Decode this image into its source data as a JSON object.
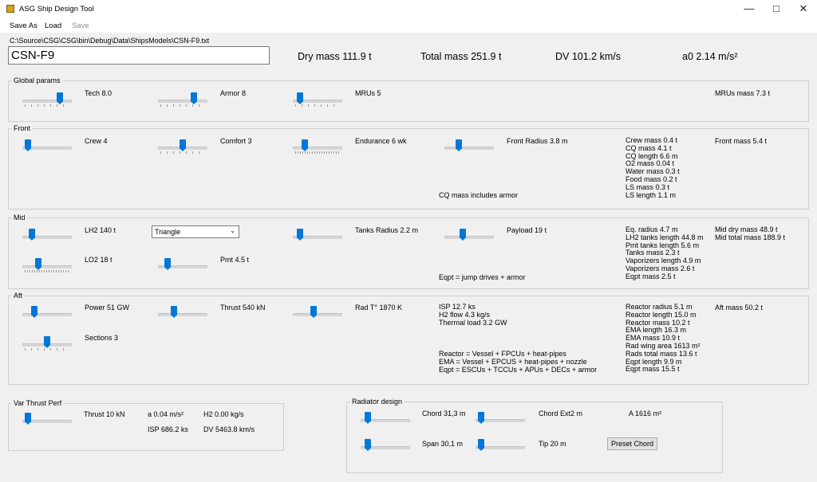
{
  "window": {
    "title": "ASG Ship Design Tool",
    "minimize_icon": "minimize-icon",
    "maximize_icon": "maximize-icon",
    "close_icon": "close-icon"
  },
  "menu": {
    "save_as": "Save As",
    "load": "Load",
    "save": "Save"
  },
  "file_path": "C:\\Source\\CSG\\CSG\\bin\\Debug\\Data\\ShipsModels\\CSN-F9.txt",
  "ship_name": "CSN-F9",
  "summary": {
    "dry_mass": "Dry mass 111.9 t",
    "total_mass": "Total mass 251.9 t",
    "dv": "DV 101.2 km/s",
    "a0": "a0 2.14 m/s²"
  },
  "global": {
    "title": "Global params",
    "tech": "Tech 8.0",
    "armor": "Armor 8",
    "mrus": "MRUs 5",
    "mrus_mass": "MRUs mass 7.3 t"
  },
  "front": {
    "title": "Front",
    "crew": "Crew 4",
    "comfort": "Comfort 3",
    "endurance": "Endurance 6 wk",
    "radius": "Front Radius 3.8 m",
    "cq_note": "CQ mass includes armor",
    "masses": [
      "Crew mass 0.4 t",
      "CQ mass 4.1 t",
      "CQ length 6.6 m",
      "O2 mass 0.04 t",
      "Water mass 0.3 t",
      "Food mass 0.2 t",
      "LS mass 0.3 t",
      "LS length 1.1 m"
    ],
    "front_mass": "Front mass 5.4 t"
  },
  "mid": {
    "title": "Mid",
    "lh2": "LH2 140 t",
    "lo2": "LO2 18 t",
    "shape": "Triangle",
    "pmt": "Pmt 4.5 t",
    "tanks_radius": "Tanks Radius 2.2 m",
    "payload": "Payload 19 t",
    "eqpt_note": "Eqpt = jump drives + armor",
    "details": [
      "Eq. radius 4.7 m",
      "LH2 tanks length 44.8 m",
      "Pmt tanks length 5.6 m",
      "Tanks mass 2.3 t",
      "Vaporizers length 4.9 m",
      "Vaporizers mass 2.6 t",
      "Eqpt mass 2.5 t"
    ],
    "dry_mass": "Mid dry mass 48.9 t",
    "total_mass": "Mid total mass 188.9 t"
  },
  "aft": {
    "title": "Aft",
    "power": "Power 51 GW",
    "thrust": "Thrust 540 kN",
    "rad_t": "Rad T° 1870 K",
    "sections": "Sections 3",
    "perf": [
      "ISP 12.7 ks",
      "H2 flow 4.3 kg/s",
      "Thermal load 3.2 GW"
    ],
    "notes": [
      "Reactor = Vessel + FPCUs + heat-pipes",
      "EMA = Vessel + EPCUS + heat-pipes + nozzle",
      "Eqpt = ESCUs + TCCUs + APUs + DECs + armor"
    ],
    "details": [
      "Reactor radius 5.1 m",
      "Reactor length 15.0 m",
      "Reactor mass 10.2 t",
      "EMA length 16.3 m",
      "EMA mass 10.9 t",
      "Rad wing area 1613 m²",
      "Rads total mass 13.6 t",
      "Eqpt length 9.9 m",
      "Eqpt mass 15.5 t"
    ],
    "aft_mass": "Aft mass 50.2 t"
  },
  "var_thrust": {
    "title": "Var Thrust Perf",
    "thrust": "Thrust 10 kN",
    "accel": "a 0.04 m/s²",
    "h2": "H2 0.00 kg/s",
    "isp": "ISP 686.2 ks",
    "dv": "DV 5463.8 km/s"
  },
  "radiator": {
    "title": "Radiator design",
    "chord": "Chord 31,3 m",
    "chord_ext": "Chord Ext2 m",
    "area": "A 1616 m²",
    "span": "Span 30,1 m",
    "tip": "Tip 20 m",
    "preset_chord": "Preset Chord"
  },
  "slider_levels": {
    "tech": 0.8,
    "armor": 0.75,
    "mrus": 0.1,
    "crew": 0.05,
    "comfort": 0.5,
    "endurance": 0.2,
    "front_radius": 0.25,
    "lh2": 0.15,
    "lo2": 0.3,
    "pmt": 0.15,
    "tanks_radius": 0.1,
    "payload": 0.35,
    "power": 0.2,
    "thrust": 0.3,
    "rad_t": 0.4,
    "sections": 0.5,
    "var_thrust": 0.05,
    "chord": 0.1,
    "chord_ext": 0.05,
    "span": 0.1,
    "tip": 0.05
  }
}
